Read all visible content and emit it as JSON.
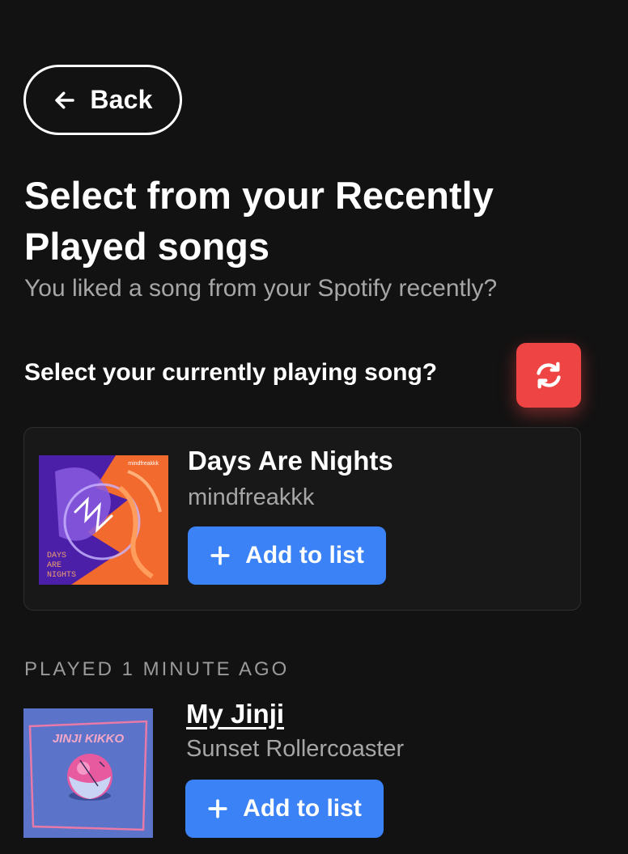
{
  "back_button": {
    "label": "Back",
    "icon": "arrow-left-icon"
  },
  "title": "Select from your Recently Played songs",
  "subtitle": "You liked a song from your Spotify recently?",
  "current_section": {
    "heading": "Select your currently playing song?",
    "refresh_icon": "refresh-icon",
    "accent_color": "#ef4444"
  },
  "current_song": {
    "title": "Days Are Nights",
    "artist": "mindfreakkk",
    "cover_text": [
      "DAYS",
      "ARE",
      "NIGHTS"
    ],
    "cover_logo": "mindfreakkk",
    "add_label": "Add to list"
  },
  "recently_played": [
    {
      "played_label": "PLAYED 1 MINUTE AGO",
      "title": "My Jinji",
      "artist": "Sunset Rollercoaster",
      "cover_text": "JINJI KIKKO",
      "add_label": "Add to list"
    }
  ],
  "colors": {
    "background": "#121212",
    "card": "#181818",
    "primary_button": "#3b82f6",
    "muted_text": "#a6a6a6"
  }
}
